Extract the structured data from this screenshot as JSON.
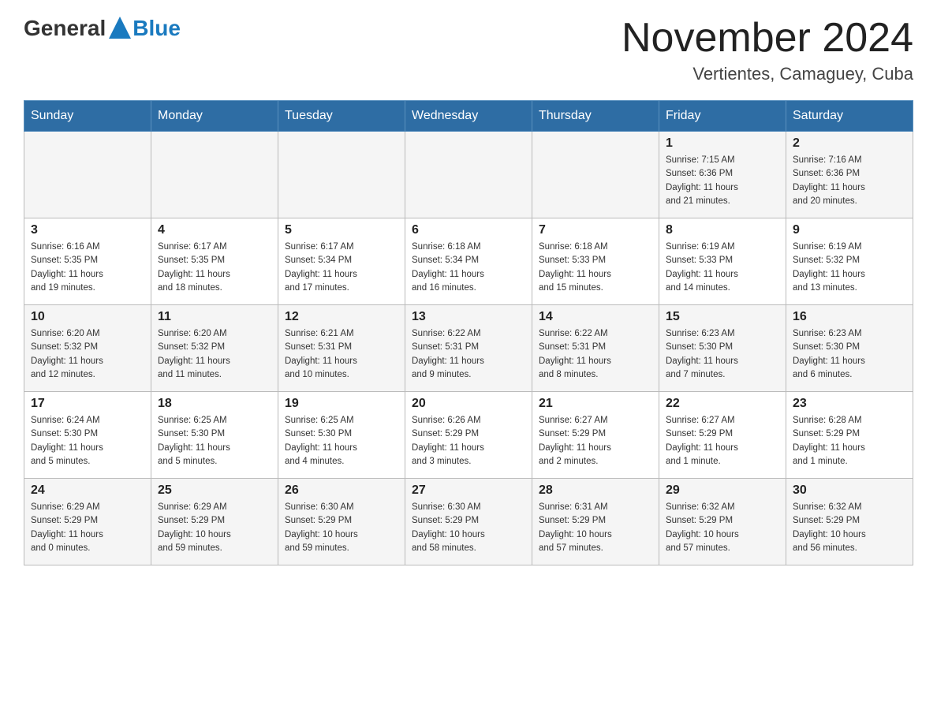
{
  "header": {
    "logo_general": "General",
    "logo_blue": "Blue",
    "month_title": "November 2024",
    "location": "Vertientes, Camaguey, Cuba"
  },
  "calendar": {
    "days_of_week": [
      "Sunday",
      "Monday",
      "Tuesday",
      "Wednesday",
      "Thursday",
      "Friday",
      "Saturday"
    ],
    "weeks": [
      [
        {
          "day": "",
          "info": ""
        },
        {
          "day": "",
          "info": ""
        },
        {
          "day": "",
          "info": ""
        },
        {
          "day": "",
          "info": ""
        },
        {
          "day": "",
          "info": ""
        },
        {
          "day": "1",
          "info": "Sunrise: 7:15 AM\nSunset: 6:36 PM\nDaylight: 11 hours\nand 21 minutes."
        },
        {
          "day": "2",
          "info": "Sunrise: 7:16 AM\nSunset: 6:36 PM\nDaylight: 11 hours\nand 20 minutes."
        }
      ],
      [
        {
          "day": "3",
          "info": "Sunrise: 6:16 AM\nSunset: 5:35 PM\nDaylight: 11 hours\nand 19 minutes."
        },
        {
          "day": "4",
          "info": "Sunrise: 6:17 AM\nSunset: 5:35 PM\nDaylight: 11 hours\nand 18 minutes."
        },
        {
          "day": "5",
          "info": "Sunrise: 6:17 AM\nSunset: 5:34 PM\nDaylight: 11 hours\nand 17 minutes."
        },
        {
          "day": "6",
          "info": "Sunrise: 6:18 AM\nSunset: 5:34 PM\nDaylight: 11 hours\nand 16 minutes."
        },
        {
          "day": "7",
          "info": "Sunrise: 6:18 AM\nSunset: 5:33 PM\nDaylight: 11 hours\nand 15 minutes."
        },
        {
          "day": "8",
          "info": "Sunrise: 6:19 AM\nSunset: 5:33 PM\nDaylight: 11 hours\nand 14 minutes."
        },
        {
          "day": "9",
          "info": "Sunrise: 6:19 AM\nSunset: 5:32 PM\nDaylight: 11 hours\nand 13 minutes."
        }
      ],
      [
        {
          "day": "10",
          "info": "Sunrise: 6:20 AM\nSunset: 5:32 PM\nDaylight: 11 hours\nand 12 minutes."
        },
        {
          "day": "11",
          "info": "Sunrise: 6:20 AM\nSunset: 5:32 PM\nDaylight: 11 hours\nand 11 minutes."
        },
        {
          "day": "12",
          "info": "Sunrise: 6:21 AM\nSunset: 5:31 PM\nDaylight: 11 hours\nand 10 minutes."
        },
        {
          "day": "13",
          "info": "Sunrise: 6:22 AM\nSunset: 5:31 PM\nDaylight: 11 hours\nand 9 minutes."
        },
        {
          "day": "14",
          "info": "Sunrise: 6:22 AM\nSunset: 5:31 PM\nDaylight: 11 hours\nand 8 minutes."
        },
        {
          "day": "15",
          "info": "Sunrise: 6:23 AM\nSunset: 5:30 PM\nDaylight: 11 hours\nand 7 minutes."
        },
        {
          "day": "16",
          "info": "Sunrise: 6:23 AM\nSunset: 5:30 PM\nDaylight: 11 hours\nand 6 minutes."
        }
      ],
      [
        {
          "day": "17",
          "info": "Sunrise: 6:24 AM\nSunset: 5:30 PM\nDaylight: 11 hours\nand 5 minutes."
        },
        {
          "day": "18",
          "info": "Sunrise: 6:25 AM\nSunset: 5:30 PM\nDaylight: 11 hours\nand 5 minutes."
        },
        {
          "day": "19",
          "info": "Sunrise: 6:25 AM\nSunset: 5:30 PM\nDaylight: 11 hours\nand 4 minutes."
        },
        {
          "day": "20",
          "info": "Sunrise: 6:26 AM\nSunset: 5:29 PM\nDaylight: 11 hours\nand 3 minutes."
        },
        {
          "day": "21",
          "info": "Sunrise: 6:27 AM\nSunset: 5:29 PM\nDaylight: 11 hours\nand 2 minutes."
        },
        {
          "day": "22",
          "info": "Sunrise: 6:27 AM\nSunset: 5:29 PM\nDaylight: 11 hours\nand 1 minute."
        },
        {
          "day": "23",
          "info": "Sunrise: 6:28 AM\nSunset: 5:29 PM\nDaylight: 11 hours\nand 1 minute."
        }
      ],
      [
        {
          "day": "24",
          "info": "Sunrise: 6:29 AM\nSunset: 5:29 PM\nDaylight: 11 hours\nand 0 minutes."
        },
        {
          "day": "25",
          "info": "Sunrise: 6:29 AM\nSunset: 5:29 PM\nDaylight: 10 hours\nand 59 minutes."
        },
        {
          "day": "26",
          "info": "Sunrise: 6:30 AM\nSunset: 5:29 PM\nDaylight: 10 hours\nand 59 minutes."
        },
        {
          "day": "27",
          "info": "Sunrise: 6:30 AM\nSunset: 5:29 PM\nDaylight: 10 hours\nand 58 minutes."
        },
        {
          "day": "28",
          "info": "Sunrise: 6:31 AM\nSunset: 5:29 PM\nDaylight: 10 hours\nand 57 minutes."
        },
        {
          "day": "29",
          "info": "Sunrise: 6:32 AM\nSunset: 5:29 PM\nDaylight: 10 hours\nand 57 minutes."
        },
        {
          "day": "30",
          "info": "Sunrise: 6:32 AM\nSunset: 5:29 PM\nDaylight: 10 hours\nand 56 minutes."
        }
      ]
    ]
  }
}
